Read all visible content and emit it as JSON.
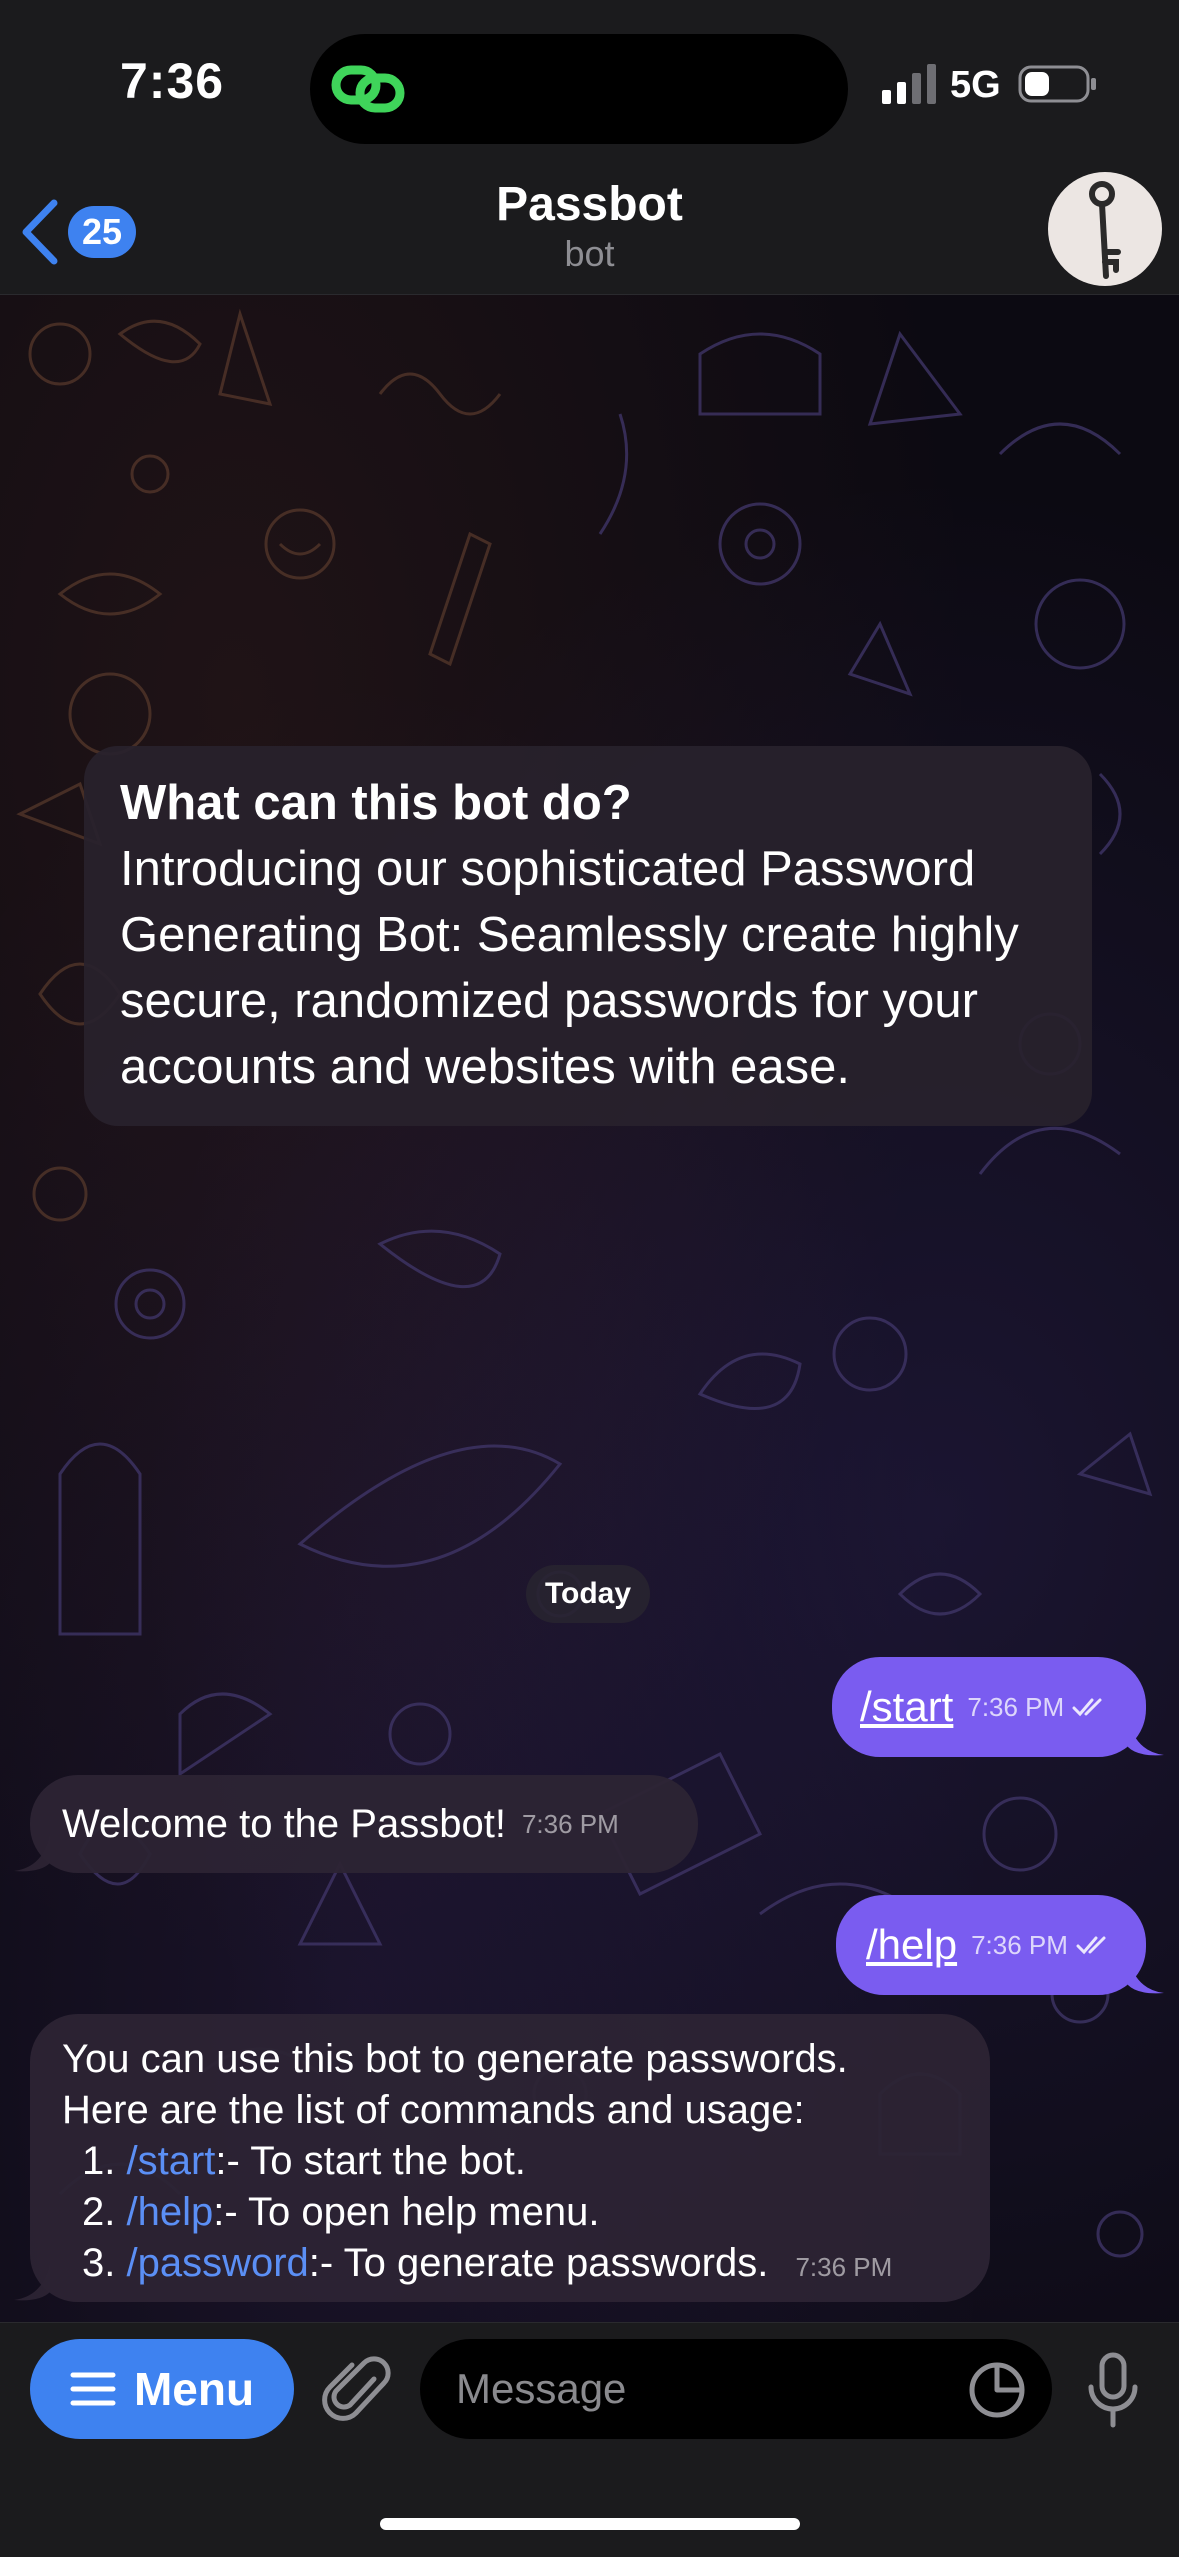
{
  "status_bar": {
    "time": "7:36",
    "network": "5G"
  },
  "header": {
    "back_count": "25",
    "title": "Passbot",
    "subtitle": "bot"
  },
  "intro": {
    "title": "What can this bot do?",
    "body": "Introducing our sophisticated Password Generating Bot: Seamlessly create highly secure, randomized passwords for your accounts and websites with ease."
  },
  "date_separator": "Today",
  "messages": {
    "start": {
      "text": "/start",
      "time": "7:36 PM"
    },
    "welcome": {
      "text": "Welcome to the Passbot!",
      "time": "7:36 PM"
    },
    "help": {
      "text": "/help",
      "time": "7:36 PM"
    },
    "help_reply": {
      "line1": "You can use this bot to generate passwords.",
      "line2": "Here are the list of commands and usage:",
      "items": [
        {
          "num": "1.",
          "cmd": "/start",
          "desc": ":- To start the bot."
        },
        {
          "num": "2.",
          "cmd": "/help",
          "desc": ":- To open help menu."
        },
        {
          "num": "3.",
          "cmd": "/password",
          "desc": ":- To generate passwords."
        }
      ],
      "time": "7:36 PM"
    }
  },
  "composer": {
    "menu_label": "Menu",
    "placeholder": "Message"
  },
  "colors": {
    "accent": "#3e82f0",
    "outgoing_bubble": "#7a5cf0",
    "link": "#5b8ff5"
  }
}
